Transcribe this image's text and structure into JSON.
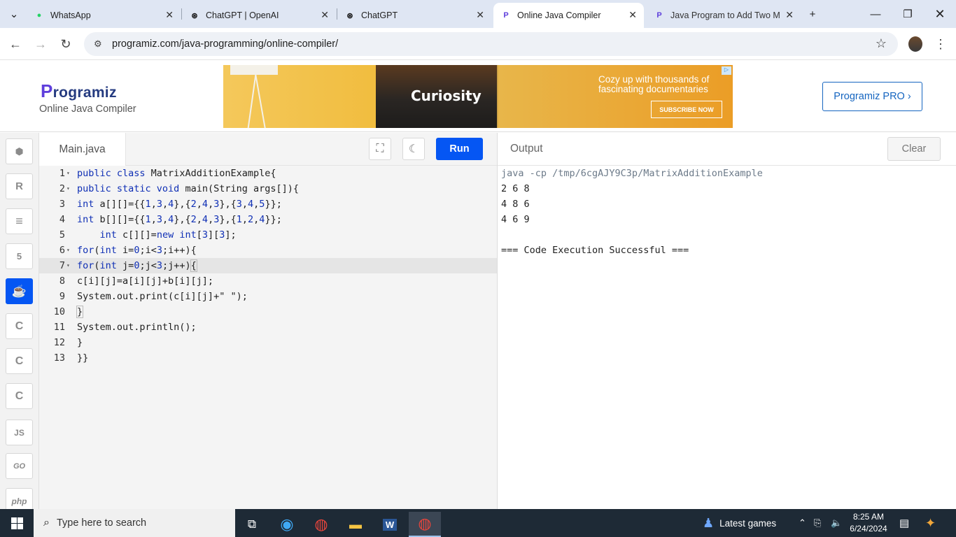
{
  "browser": {
    "tabs": [
      {
        "label": "WhatsApp",
        "icon": "whatsapp-icon"
      },
      {
        "label": "ChatGPT | OpenAI",
        "icon": "openai-icon"
      },
      {
        "label": "ChatGPT",
        "icon": "openai-icon"
      },
      {
        "label": "Online Java Compiler",
        "icon": "programiz-icon",
        "active": true
      },
      {
        "label": "Java Program to Add Two M",
        "icon": "programiz-icon"
      }
    ],
    "url": "programiz.com/java-programming/online-compiler/"
  },
  "header": {
    "logo": "rogramiz",
    "logo_p": "P",
    "subtitle": "Online Java Compiler",
    "pro_button": "Programiz PRO ›",
    "ad": {
      "brand": "Curiosity",
      "headline": "Cozy up with thousands of fascinating documentaries",
      "cta": "SUBSCRIBE NOW"
    }
  },
  "sidebar": {
    "languages": [
      {
        "name": "python",
        "glyph": "🐍"
      },
      {
        "name": "r",
        "glyph": "R"
      },
      {
        "name": "sql",
        "glyph": "≡"
      },
      {
        "name": "html",
        "glyph": "5"
      },
      {
        "name": "java",
        "glyph": "☕",
        "active": true
      },
      {
        "name": "c",
        "glyph": "C"
      },
      {
        "name": "cpp",
        "glyph": "C"
      },
      {
        "name": "csharp",
        "glyph": "C"
      },
      {
        "name": "javascript",
        "glyph": "JS"
      },
      {
        "name": "go",
        "glyph": "GO"
      },
      {
        "name": "php",
        "glyph": "php"
      }
    ]
  },
  "editor": {
    "filename": "Main.java",
    "run_label": "Run",
    "lines": [
      "public class MatrixAdditionExample{",
      "public static void main(String args[]){",
      "int a[][]={{1,3,4},{2,4,3},{3,4,5}};",
      "int b[][]={{1,3,4},{2,4,3},{1,2,4}};",
      "    int c[][]=new int[3][3];",
      "for(int i=0;i<3;i++){",
      "for(int j=0;j<3;j++){",
      "c[i][j]=a[i][j]+b[i][j];",
      "System.out.print(c[i][j]+\" \");",
      "}",
      "System.out.println();",
      "}",
      "}}"
    ],
    "current_line": 7
  },
  "output": {
    "title": "Output",
    "clear_label": "Clear",
    "lines": [
      "java -cp /tmp/6cgAJY9C3p/MatrixAdditionExample",
      "2 6 8",
      "4 8 6",
      "4 6 9",
      "",
      "=== Code Execution Successful ==="
    ]
  },
  "taskbar": {
    "search_placeholder": "Type here to search",
    "games": "Latest games",
    "time": "8:25 AM",
    "date": "6/24/2024"
  }
}
